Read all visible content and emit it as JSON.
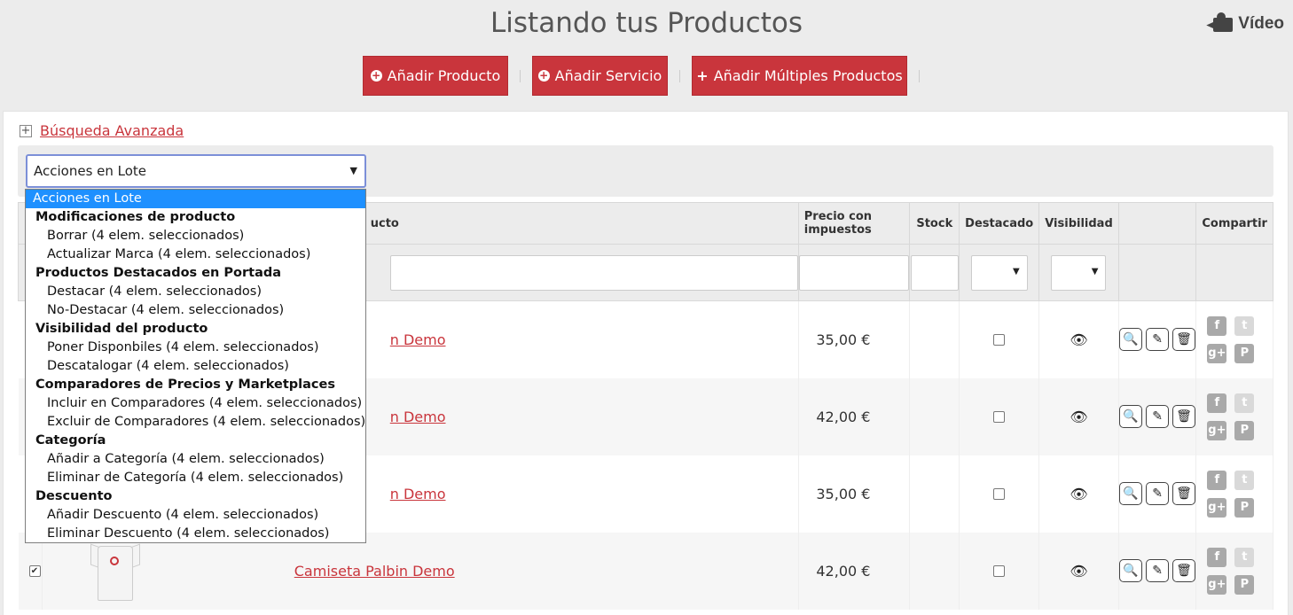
{
  "header": {
    "title": "Listando tus Productos",
    "video_label": "Vídeo"
  },
  "actions": {
    "add_product": "Añadir Producto",
    "add_service": "Añadir Servicio",
    "add_multiple": "Añadir Múltiples Productos"
  },
  "advanced_search": {
    "label": "Búsqueda Avanzada",
    "expand_symbol": "+"
  },
  "batch": {
    "selected": "Acciones en Lote",
    "groups": [
      {
        "label": "Modificaciones de producto",
        "options": [
          "Borrar (4 elem. seleccionados)",
          "Actualizar Marca (4 elem. seleccionados)"
        ]
      },
      {
        "label": "Productos Destacados en Portada",
        "options": [
          "Destacar (4 elem. seleccionados)",
          "No-Destacar (4 elem. seleccionados)"
        ]
      },
      {
        "label": "Visibilidad del producto",
        "options": [
          "Poner Disponbiles (4 elem. seleccionados)",
          "Descatalogar (4 elem. seleccionados)"
        ]
      },
      {
        "label": "Comparadores de Precios y Marketplaces",
        "options": [
          "Incluir en Comparadores (4 elem. seleccionados)",
          "Excluir de Comparadores (4 elem. seleccionados)"
        ]
      },
      {
        "label": "Categoría",
        "options": [
          "Añadir a Categoría (4 elem. seleccionados)",
          "Eliminar de Categoría (4 elem. seleccionados)"
        ]
      },
      {
        "label": "Descuento",
        "options": [
          "Añadir Descuento (4 elem. seleccionados)",
          "Eliminar Descuento (4 elem. seleccionados)"
        ]
      }
    ]
  },
  "table": {
    "headers": {
      "product": "ucto",
      "price": "Precio con impuestos",
      "stock": "Stock",
      "featured": "Destacado",
      "visibility": "Visibilidad",
      "share": "Compartir"
    },
    "rows": [
      {
        "name": "n Demo",
        "price": "35,00 €",
        "checked": false
      },
      {
        "name": "n Demo",
        "price": "42,00 €",
        "checked": false
      },
      {
        "name": "n Demo",
        "price": "35,00 €",
        "checked": false
      },
      {
        "name": "Camiseta Palbin Demo",
        "price": "42,00 €",
        "checked": true
      }
    ]
  },
  "icons": {
    "view": "🔍",
    "edit": "✎",
    "delete": "🗑",
    "eye": "👁",
    "facebook": "f",
    "twitter": "t",
    "googleplus": "g+",
    "pinterest": "P"
  },
  "colors": {
    "accent": "#c9353c",
    "dropdown_highlight": "#1e90ff"
  }
}
